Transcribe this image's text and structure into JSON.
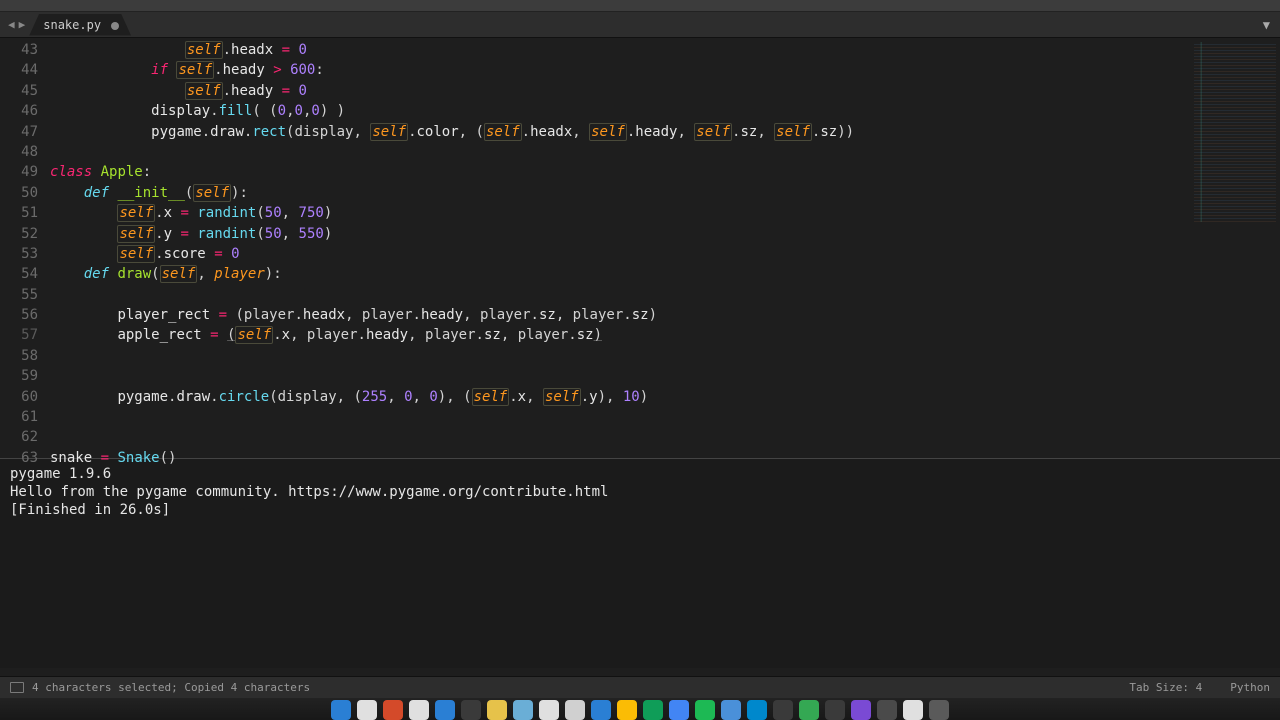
{
  "tab": {
    "filename": "snake.py"
  },
  "gutter_start": 43,
  "lines": [
    {
      "n": 43,
      "tokens": [
        [
          "ws",
          "                "
        ],
        [
          "self",
          "self"
        ],
        [
          "p",
          "."
        ],
        [
          "prop",
          "headx"
        ],
        [
          "p",
          " "
        ],
        [
          "op",
          "="
        ],
        [
          "p",
          " "
        ],
        [
          "num",
          "0"
        ]
      ]
    },
    {
      "n": 44,
      "tokens": [
        [
          "ws",
          "            "
        ],
        [
          "kw",
          "if"
        ],
        [
          "p",
          " "
        ],
        [
          "self",
          "self"
        ],
        [
          "p",
          "."
        ],
        [
          "prop",
          "heady"
        ],
        [
          "p",
          " "
        ],
        [
          "op",
          ">"
        ],
        [
          "p",
          " "
        ],
        [
          "num",
          "600"
        ],
        [
          "p",
          ":"
        ]
      ]
    },
    {
      "n": 45,
      "tokens": [
        [
          "ws",
          "                "
        ],
        [
          "self",
          "self"
        ],
        [
          "p",
          "."
        ],
        [
          "prop",
          "heady"
        ],
        [
          "p",
          " "
        ],
        [
          "op",
          "="
        ],
        [
          "p",
          " "
        ],
        [
          "num",
          "0"
        ]
      ]
    },
    {
      "n": 46,
      "tokens": [
        [
          "ws",
          "            "
        ],
        [
          "ident",
          "display"
        ],
        [
          "p",
          "."
        ],
        [
          "fn",
          "fill"
        ],
        [
          "p",
          "( ("
        ],
        [
          "num",
          "0"
        ],
        [
          "p",
          ","
        ],
        [
          "num",
          "0"
        ],
        [
          "p",
          ","
        ],
        [
          "num",
          "0"
        ],
        [
          "p",
          ") )"
        ]
      ]
    },
    {
      "n": 47,
      "tokens": [
        [
          "ws",
          "            "
        ],
        [
          "ident",
          "pygame"
        ],
        [
          "p",
          "."
        ],
        [
          "ident",
          "draw"
        ],
        [
          "p",
          "."
        ],
        [
          "fn",
          "rect"
        ],
        [
          "p",
          "(display, "
        ],
        [
          "self",
          "self"
        ],
        [
          "p",
          "."
        ],
        [
          "prop",
          "color"
        ],
        [
          "p",
          ", ("
        ],
        [
          "self",
          "self"
        ],
        [
          "p",
          "."
        ],
        [
          "prop",
          "headx"
        ],
        [
          "p",
          ", "
        ],
        [
          "self",
          "self"
        ],
        [
          "p",
          "."
        ],
        [
          "prop",
          "heady"
        ],
        [
          "p",
          ", "
        ],
        [
          "self",
          "self"
        ],
        [
          "p",
          "."
        ],
        [
          "prop",
          "sz"
        ],
        [
          "p",
          ", "
        ],
        [
          "self",
          "self"
        ],
        [
          "p",
          "."
        ],
        [
          "prop",
          "sz"
        ],
        [
          "p",
          "))"
        ]
      ]
    },
    {
      "n": 48,
      "tokens": []
    },
    {
      "n": 49,
      "tokens": [
        [
          "kw",
          "class"
        ],
        [
          "p",
          " "
        ],
        [
          "cls",
          "Apple"
        ],
        [
          "p",
          ":"
        ]
      ]
    },
    {
      "n": 50,
      "tokens": [
        [
          "ws",
          "    "
        ],
        [
          "def",
          "def"
        ],
        [
          "p",
          " "
        ],
        [
          "fnname",
          "__init__"
        ],
        [
          "p",
          "("
        ],
        [
          "self",
          "self"
        ],
        [
          "p",
          "):"
        ]
      ]
    },
    {
      "n": 51,
      "tokens": [
        [
          "ws",
          "        "
        ],
        [
          "self",
          "self"
        ],
        [
          "p",
          "."
        ],
        [
          "prop",
          "x"
        ],
        [
          "p",
          " "
        ],
        [
          "op",
          "="
        ],
        [
          "p",
          " "
        ],
        [
          "fn",
          "randint"
        ],
        [
          "p",
          "("
        ],
        [
          "num",
          "50"
        ],
        [
          "p",
          ", "
        ],
        [
          "num",
          "750"
        ],
        [
          "p",
          ")"
        ]
      ]
    },
    {
      "n": 52,
      "tokens": [
        [
          "ws",
          "        "
        ],
        [
          "self",
          "self"
        ],
        [
          "p",
          "."
        ],
        [
          "prop",
          "y"
        ],
        [
          "p",
          " "
        ],
        [
          "op",
          "="
        ],
        [
          "p",
          " "
        ],
        [
          "fn",
          "randint"
        ],
        [
          "p",
          "("
        ],
        [
          "num",
          "50"
        ],
        [
          "p",
          ", "
        ],
        [
          "num",
          "550"
        ],
        [
          "p",
          ")"
        ]
      ]
    },
    {
      "n": 53,
      "tokens": [
        [
          "ws",
          "        "
        ],
        [
          "self",
          "self"
        ],
        [
          "p",
          "."
        ],
        [
          "prop",
          "score"
        ],
        [
          "p",
          " "
        ],
        [
          "op",
          "="
        ],
        [
          "p",
          " "
        ],
        [
          "num",
          "0"
        ]
      ]
    },
    {
      "n": 54,
      "tokens": [
        [
          "ws",
          "    "
        ],
        [
          "def",
          "def"
        ],
        [
          "p",
          " "
        ],
        [
          "fnname",
          "draw"
        ],
        [
          "p",
          "("
        ],
        [
          "self",
          "self"
        ],
        [
          "p",
          ", "
        ],
        [
          "arg",
          "player"
        ],
        [
          "p",
          "):"
        ]
      ]
    },
    {
      "n": 55,
      "tokens": []
    },
    {
      "n": 56,
      "tokens": [
        [
          "ws",
          "        "
        ],
        [
          "ident",
          "player_rect"
        ],
        [
          "p",
          " "
        ],
        [
          "op",
          "="
        ],
        [
          "p",
          " (player"
        ],
        [
          "p",
          "."
        ],
        [
          "prop",
          "headx"
        ],
        [
          "p",
          ", player"
        ],
        [
          "p",
          "."
        ],
        [
          "prop",
          "heady"
        ],
        [
          "p",
          ", player"
        ],
        [
          "p",
          "."
        ],
        [
          "prop",
          "sz"
        ],
        [
          "p",
          ", player"
        ],
        [
          "p",
          "."
        ],
        [
          "prop",
          "sz"
        ],
        [
          "p",
          ")"
        ]
      ]
    },
    {
      "n": 57,
      "paren": true,
      "tokens": [
        [
          "ws",
          "        "
        ],
        [
          "ident",
          "apple_rect"
        ],
        [
          "p",
          " "
        ],
        [
          "op",
          "="
        ],
        [
          "p",
          " "
        ],
        [
          "ul",
          "("
        ],
        [
          "self",
          "self"
        ],
        [
          "p",
          "."
        ],
        [
          "prop",
          "x"
        ],
        [
          "p",
          ", player"
        ],
        [
          "p",
          "."
        ],
        [
          "prop",
          "heady"
        ],
        [
          "p",
          ", player"
        ],
        [
          "p",
          "."
        ],
        [
          "prop",
          "sz"
        ],
        [
          "p",
          ", player"
        ],
        [
          "p",
          "."
        ],
        [
          "prop",
          "sz"
        ],
        [
          "ul",
          ")"
        ]
      ]
    },
    {
      "n": 58,
      "tokens": []
    },
    {
      "n": 59,
      "tokens": []
    },
    {
      "n": 60,
      "tokens": [
        [
          "ws",
          "        "
        ],
        [
          "ident",
          "pygame"
        ],
        [
          "p",
          "."
        ],
        [
          "ident",
          "draw"
        ],
        [
          "p",
          "."
        ],
        [
          "fn",
          "circle"
        ],
        [
          "p",
          "(display, ("
        ],
        [
          "num",
          "255"
        ],
        [
          "p",
          ", "
        ],
        [
          "num",
          "0"
        ],
        [
          "p",
          ", "
        ],
        [
          "num",
          "0"
        ],
        [
          "p",
          "), ("
        ],
        [
          "self",
          "self"
        ],
        [
          "p",
          "."
        ],
        [
          "prop",
          "x"
        ],
        [
          "p",
          ", "
        ],
        [
          "self",
          "self"
        ],
        [
          "p",
          "."
        ],
        [
          "prop",
          "y"
        ],
        [
          "p",
          "), "
        ],
        [
          "num",
          "10"
        ],
        [
          "p",
          ")"
        ]
      ]
    },
    {
      "n": 61,
      "tokens": []
    },
    {
      "n": 62,
      "tokens": []
    },
    {
      "n": 63,
      "tokens": [
        [
          "ident",
          "snake"
        ],
        [
          "p",
          " "
        ],
        [
          "op",
          "="
        ],
        [
          "p",
          " "
        ],
        [
          "fn",
          "Snake"
        ],
        [
          "p",
          "()"
        ]
      ]
    }
  ],
  "console": {
    "l1": "pygame 1.9.6",
    "l2": "Hello from the pygame community. https://www.pygame.org/contribute.html",
    "l3": "[Finished in 26.0s]"
  },
  "status": {
    "message": "4 characters selected; Copied 4 characters",
    "tabsize": "Tab Size: 4",
    "syntax": "Python"
  },
  "dock_colors": [
    "#2a7fd4",
    "#e0e0e0",
    "#d44a2a",
    "#e0e0e0",
    "#2a7fd4",
    "#3a3a3a",
    "#e6c24a",
    "#6aaed6",
    "#e0e0e0",
    "#d0d0d0",
    "#2a7fd4",
    "#fbbc05",
    "#0f9d58",
    "#4285f4",
    "#1db954",
    "#4a90d9",
    "#0088cc",
    "#3a3a3a",
    "#34a853",
    "#3a3a3a",
    "#7a4ad4",
    "#4a4a4a",
    "#e0e0e0",
    "#5a5a5a"
  ]
}
